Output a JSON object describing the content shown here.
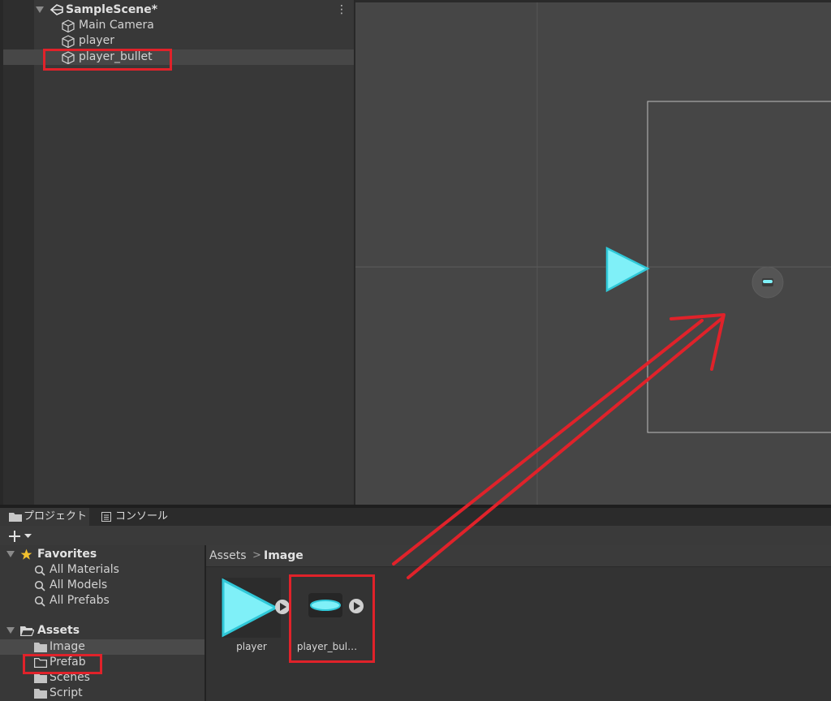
{
  "hierarchy": {
    "scene_name": "SampleScene*",
    "items": [
      {
        "label": "Main Camera"
      },
      {
        "label": "player"
      },
      {
        "label": "player_bullet"
      }
    ]
  },
  "tabs": [
    {
      "label": "プロジェクト",
      "icon": "folder-icon"
    },
    {
      "label": "コンソール",
      "icon": "console-icon"
    }
  ],
  "toolbar": {
    "add_icon": "plus-icon",
    "dropdown_icon": "chevron-down-icon"
  },
  "favorites": {
    "label": "Favorites",
    "items": [
      {
        "label": "All Materials"
      },
      {
        "label": "All Models"
      },
      {
        "label": "All Prefabs"
      }
    ]
  },
  "assets_tree": {
    "label": "Assets",
    "folders": [
      {
        "label": "Image"
      },
      {
        "label": "Prefab"
      },
      {
        "label": "Scenes"
      },
      {
        "label": "Script"
      }
    ]
  },
  "breadcrumb": {
    "root": "Assets",
    "separator": ">",
    "current": "Image"
  },
  "assets": [
    {
      "name": "player",
      "icon": "triangle-sprite"
    },
    {
      "name": "player_bul…",
      "icon": "bullet-sprite"
    }
  ],
  "colors": {
    "highlight_red": "#e0222a",
    "sprite_cyan": "#7ff0f8",
    "sprite_cyan_dark": "#2fc8d8",
    "favorites_star": "#f2c12e"
  }
}
